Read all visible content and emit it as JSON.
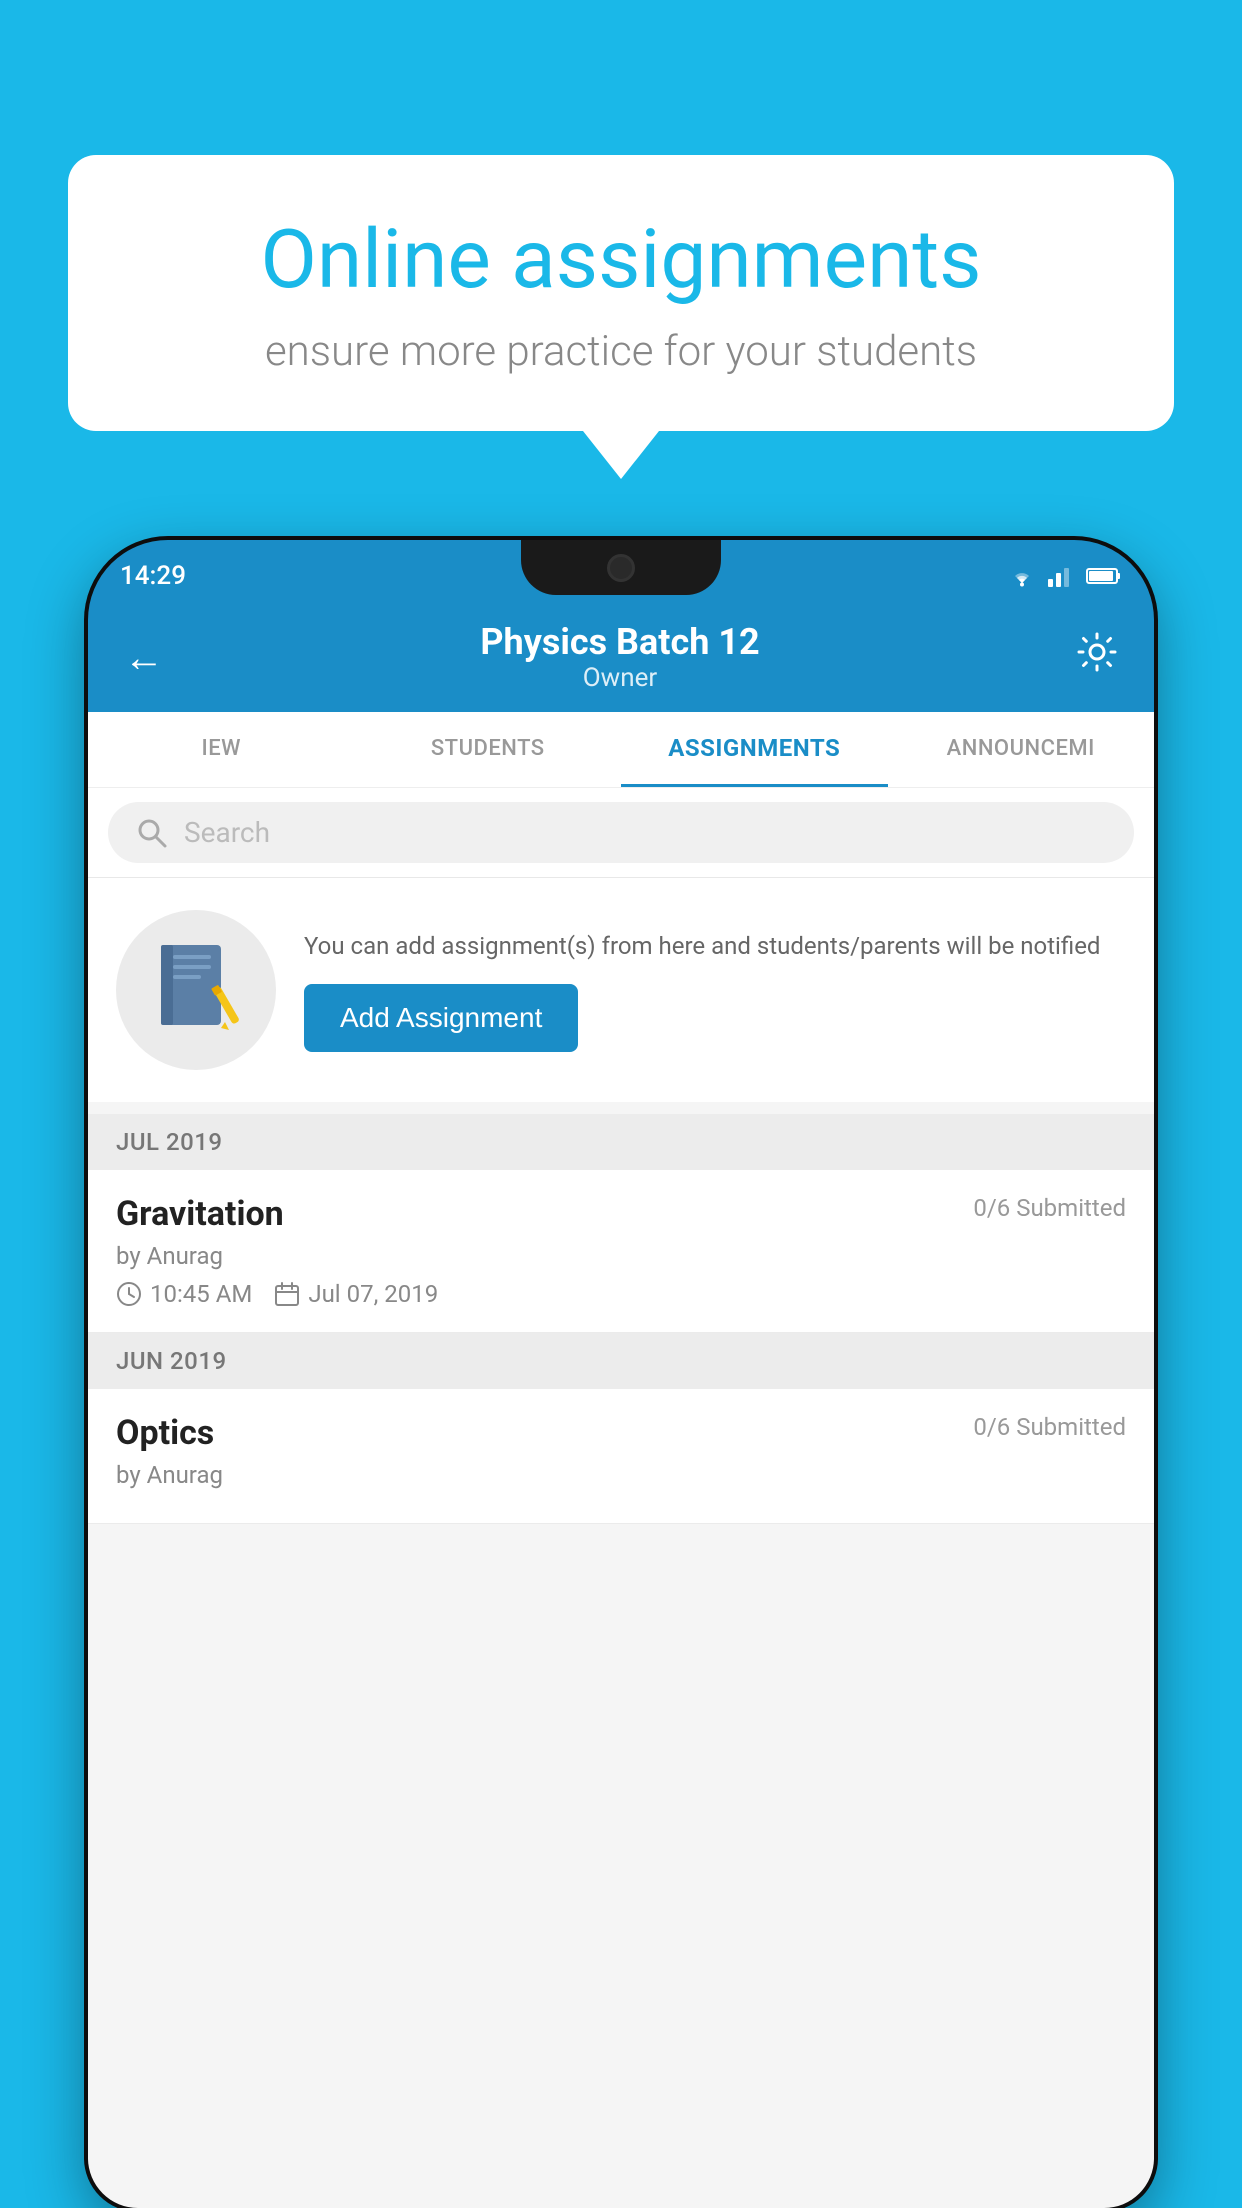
{
  "background_color": "#1ab8e8",
  "speech_bubble": {
    "title": "Online assignments",
    "subtitle": "ensure more practice for your students"
  },
  "status_bar": {
    "time": "14:29",
    "icons": [
      "wifi",
      "signal",
      "battery"
    ]
  },
  "app_header": {
    "title": "Physics Batch 12",
    "subtitle": "Owner",
    "back_label": "←",
    "settings_label": "⚙"
  },
  "tabs": [
    {
      "label": "IEW",
      "active": false
    },
    {
      "label": "STUDENTS",
      "active": false
    },
    {
      "label": "ASSIGNMENTS",
      "active": true
    },
    {
      "label": "ANNOUNCEMI",
      "active": false
    }
  ],
  "search": {
    "placeholder": "Search"
  },
  "promo": {
    "text": "You can add assignment(s) from here and students/parents will be notified",
    "button_label": "Add Assignment"
  },
  "sections": [
    {
      "month_label": "JUL 2019",
      "assignments": [
        {
          "name": "Gravitation",
          "submitted": "0/6 Submitted",
          "author": "by Anurag",
          "time": "10:45 AM",
          "date": "Jul 07, 2019"
        }
      ]
    },
    {
      "month_label": "JUN 2019",
      "assignments": [
        {
          "name": "Optics",
          "submitted": "0/6 Submitted",
          "author": "by Anurag",
          "time": "",
          "date": ""
        }
      ]
    }
  ]
}
